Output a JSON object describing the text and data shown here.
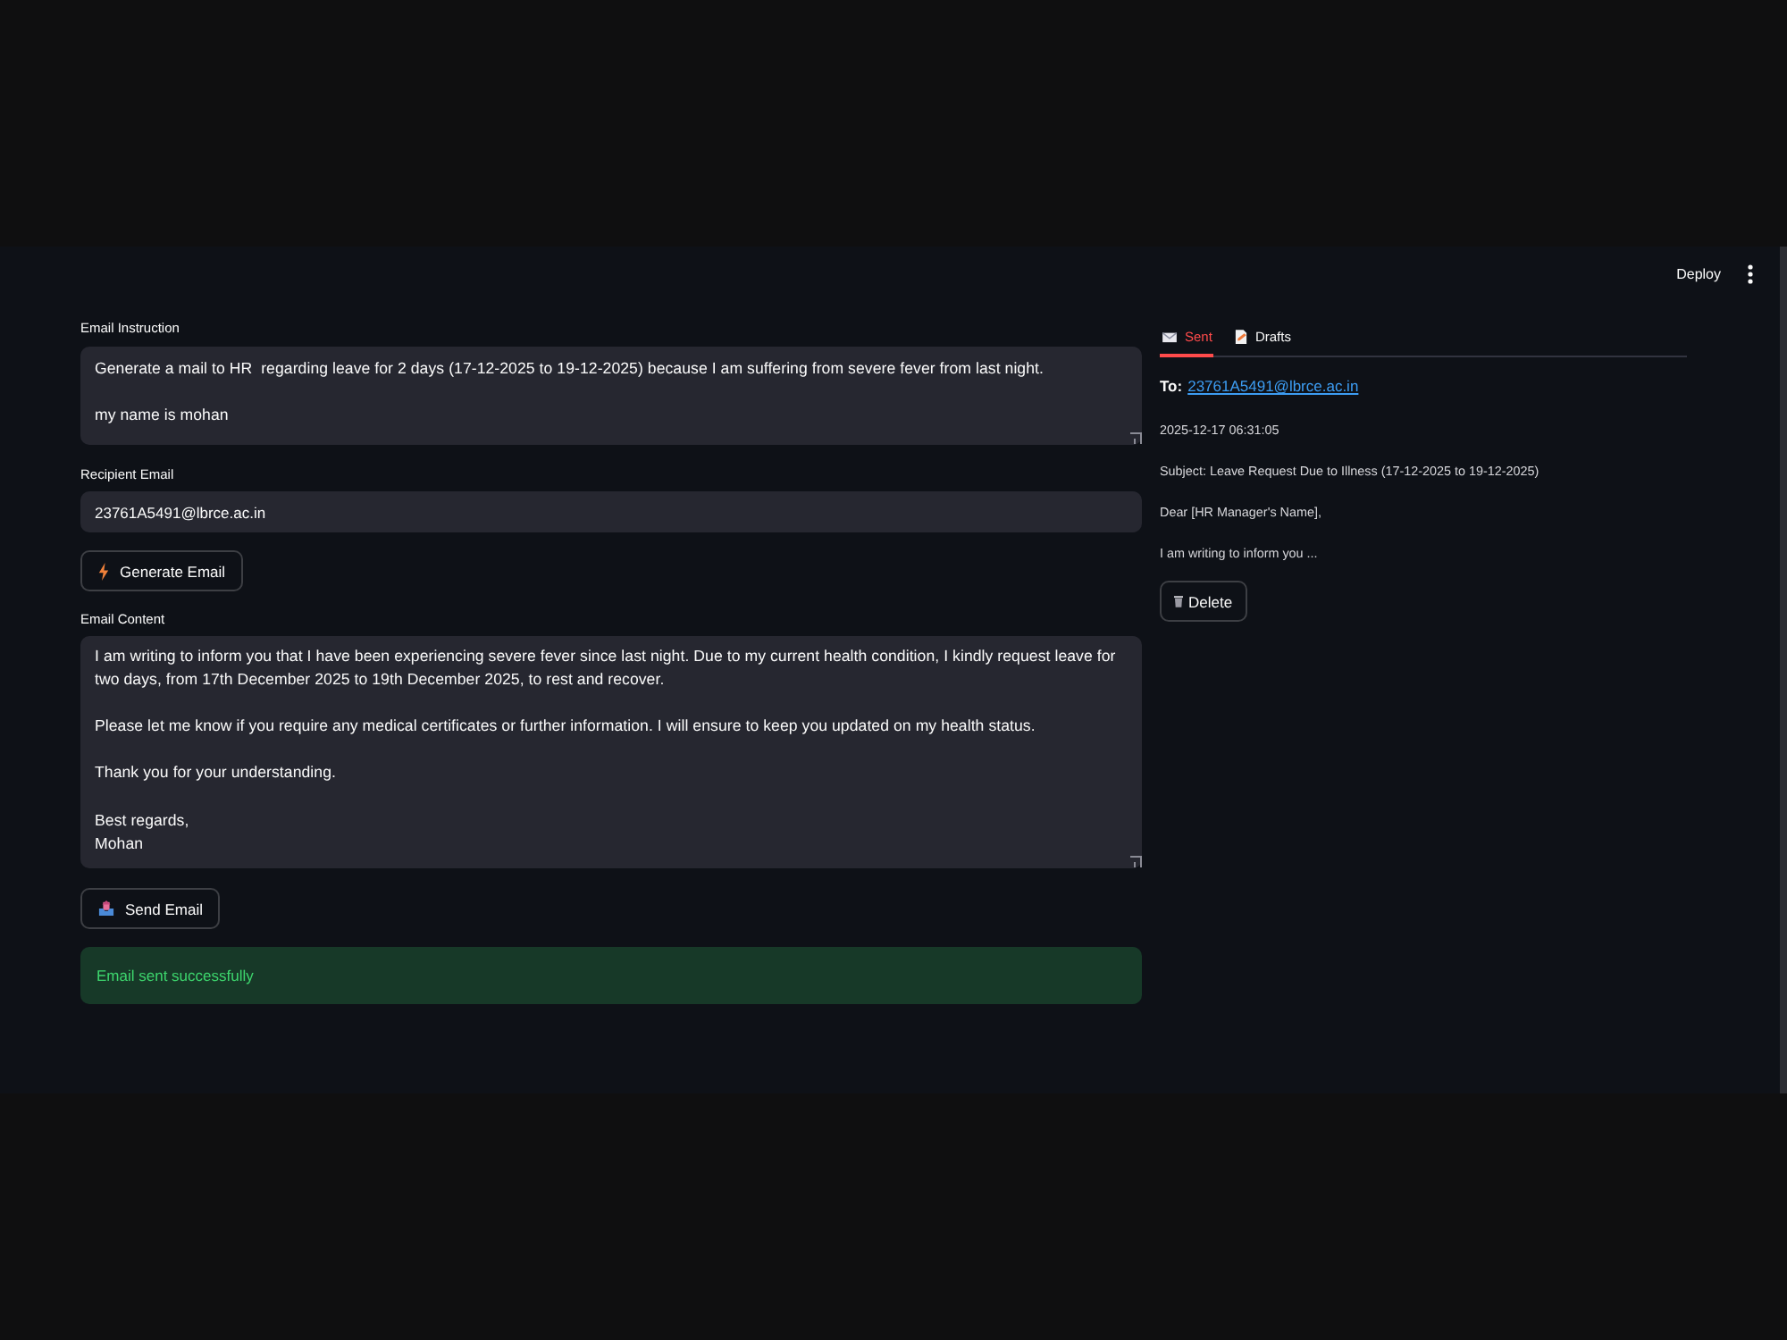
{
  "header": {
    "deploy_button": "Deploy"
  },
  "form": {
    "instruction": {
      "label": "Email Instruction",
      "value": "Generate a mail to HR  regarding leave for 2 days (17-12-2025 to 19-12-2025) because I am suffering from severe fever from last night.\n\nmy name is mohan"
    },
    "recipient": {
      "label": "Recipient Email",
      "value": "23761A5491@lbrce.ac.in"
    },
    "generate_button": "Generate Email",
    "content": {
      "label": "Email Content",
      "value": "I am writing to inform you that I have been experiencing severe fever since last night. Due to my current health condition, I kindly request leave for two days, from 17th December 2025 to 19th December 2025, to rest and recover.\n\nPlease let me know if you require any medical certificates or further information. I will ensure to keep you updated on my health status.\n\nThank you for your understanding.\n\nBest regards,\nMohan"
    },
    "send_button": "Send Email",
    "alert": {
      "kind": "success",
      "message": "Email sent successfully"
    }
  },
  "history": {
    "tabs": [
      {
        "label": "Sent",
        "selected": true
      },
      {
        "label": "Drafts",
        "selected": false
      }
    ],
    "email": {
      "to_label": "To:",
      "to": "23761A5491@lbrce.ac.in",
      "timestamp": "2025-12-17 06:31:05",
      "subject": "Subject: Leave Request Due to Illness (17-12-2025 to 19-12-2025)",
      "greeting": "Dear [HR Manager's Name],",
      "preview": "I am writing to inform you ...",
      "delete_button": "Delete"
    }
  }
}
